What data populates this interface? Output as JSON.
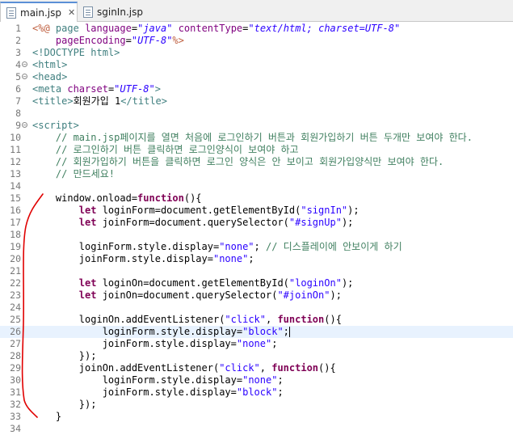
{
  "tabs": [
    {
      "label": "main.jsp",
      "close": "✕"
    },
    {
      "label": "sginIn.jsp"
    }
  ],
  "colors": {
    "tag": "#3f7f7f",
    "attr": "#7f007f",
    "string": "#2a00ff",
    "comment": "#3f7f5f",
    "keyword": "#7f0055",
    "directive": "#bf5f3f",
    "current_line": "#e8f2fe",
    "annotation": "#e00000"
  },
  "editor": {
    "current_line": 26,
    "lines": [
      {
        "n": "1",
        "fold": false,
        "tokens": [
          [
            "dir",
            "<%@"
          ],
          [
            "plain",
            " "
          ],
          [
            "tag",
            "page"
          ],
          [
            "plain",
            " "
          ],
          [
            "attr",
            "language"
          ],
          [
            "plain",
            "="
          ],
          [
            "str",
            "\"java\""
          ],
          [
            "plain",
            " "
          ],
          [
            "attr",
            "contentType"
          ],
          [
            "plain",
            "="
          ],
          [
            "str",
            "\"text/html; charset=UTF-8\""
          ]
        ]
      },
      {
        "n": "2",
        "fold": false,
        "tokens": [
          [
            "plain",
            "    "
          ],
          [
            "attr",
            "pageEncoding"
          ],
          [
            "plain",
            "="
          ],
          [
            "str",
            "\"UTF-8\""
          ],
          [
            "dir",
            "%>"
          ]
        ]
      },
      {
        "n": "3",
        "fold": false,
        "tokens": [
          [
            "tag",
            "<!DOCTYPE html>"
          ]
        ]
      },
      {
        "n": "4",
        "fold": true,
        "tokens": [
          [
            "tag",
            "<html>"
          ]
        ]
      },
      {
        "n": "5",
        "fold": true,
        "tokens": [
          [
            "tag",
            "<head>"
          ]
        ]
      },
      {
        "n": "6",
        "fold": false,
        "tokens": [
          [
            "tag",
            "<meta"
          ],
          [
            "plain",
            " "
          ],
          [
            "attr",
            "charset"
          ],
          [
            "plain",
            "="
          ],
          [
            "str",
            "\"UTF-8\""
          ],
          [
            "tag",
            ">"
          ]
        ]
      },
      {
        "n": "7",
        "fold": false,
        "tokens": [
          [
            "tag",
            "<title>"
          ],
          [
            "plain",
            "회원가입 1"
          ],
          [
            "tag",
            "</title>"
          ]
        ]
      },
      {
        "n": "8",
        "fold": false,
        "tokens": []
      },
      {
        "n": "9",
        "fold": true,
        "tokens": [
          [
            "tag",
            "<script>"
          ]
        ]
      },
      {
        "n": "10",
        "fold": false,
        "tokens": [
          [
            "com",
            "    // main.jsp페이지를 열면 처음에 로그인하기 버튼과 회원가입하기 버튼 두개만 보여야 한다."
          ]
        ]
      },
      {
        "n": "11",
        "fold": false,
        "tokens": [
          [
            "com",
            "    // 로그인하기 버튼 클릭하면 로그인양식이 보여야 하고"
          ]
        ]
      },
      {
        "n": "12",
        "fold": false,
        "tokens": [
          [
            "com",
            "    // 회원가입하기 버튼을 클릭하면 로그인 양식은 안 보이고 회원가입양식만 보여야 한다."
          ]
        ]
      },
      {
        "n": "13",
        "fold": false,
        "tokens": [
          [
            "com",
            "    // 만드세요!"
          ]
        ]
      },
      {
        "n": "14",
        "fold": false,
        "tokens": []
      },
      {
        "n": "15",
        "fold": false,
        "tokens": [
          [
            "plain",
            "    window.onload="
          ],
          [
            "kw",
            "function"
          ],
          [
            "plain",
            "(){"
          ]
        ]
      },
      {
        "n": "16",
        "fold": false,
        "tokens": [
          [
            "plain",
            "        "
          ],
          [
            "kw",
            "let"
          ],
          [
            "plain",
            " loginForm=document.getElementById("
          ],
          [
            "strjs",
            "\"signIn\""
          ],
          [
            "plain",
            ");"
          ]
        ]
      },
      {
        "n": "17",
        "fold": false,
        "tokens": [
          [
            "plain",
            "        "
          ],
          [
            "kw",
            "let"
          ],
          [
            "plain",
            " joinForm=document.querySelector("
          ],
          [
            "strjs",
            "\"#signUp\""
          ],
          [
            "plain",
            ");"
          ]
        ]
      },
      {
        "n": "18",
        "fold": false,
        "tokens": []
      },
      {
        "n": "19",
        "fold": false,
        "tokens": [
          [
            "plain",
            "        loginForm.style.display="
          ],
          [
            "strjs",
            "\"none\""
          ],
          [
            "plain",
            "; "
          ],
          [
            "com",
            "// 디스플레이에 안보이게 하기"
          ]
        ]
      },
      {
        "n": "20",
        "fold": false,
        "tokens": [
          [
            "plain",
            "        joinForm.style.display="
          ],
          [
            "strjs",
            "\"none\""
          ],
          [
            "plain",
            ";"
          ]
        ]
      },
      {
        "n": "21",
        "fold": false,
        "tokens": []
      },
      {
        "n": "22",
        "fold": false,
        "tokens": [
          [
            "plain",
            "        "
          ],
          [
            "kw",
            "let"
          ],
          [
            "plain",
            " loginOn=document.getElementById("
          ],
          [
            "strjs",
            "\"loginOn\""
          ],
          [
            "plain",
            ");"
          ]
        ]
      },
      {
        "n": "23",
        "fold": false,
        "tokens": [
          [
            "plain",
            "        "
          ],
          [
            "kw",
            "let"
          ],
          [
            "plain",
            " joinOn=document.querySelector("
          ],
          [
            "strjs",
            "\"#joinOn\""
          ],
          [
            "plain",
            ");"
          ]
        ]
      },
      {
        "n": "24",
        "fold": false,
        "tokens": []
      },
      {
        "n": "25",
        "fold": false,
        "tokens": [
          [
            "plain",
            "        loginOn.addEventListener("
          ],
          [
            "strjs",
            "\"click\""
          ],
          [
            "plain",
            ", "
          ],
          [
            "kw",
            "function"
          ],
          [
            "plain",
            "(){"
          ]
        ]
      },
      {
        "n": "26",
        "fold": false,
        "tokens": [
          [
            "plain",
            "            loginForm.style.display="
          ],
          [
            "strjs",
            "\"block\""
          ],
          [
            "plain",
            ";"
          ],
          [
            "caret",
            ""
          ]
        ]
      },
      {
        "n": "27",
        "fold": false,
        "tokens": [
          [
            "plain",
            "            joinForm.style.display="
          ],
          [
            "strjs",
            "\"none\""
          ],
          [
            "plain",
            ";"
          ]
        ]
      },
      {
        "n": "28",
        "fold": false,
        "tokens": [
          [
            "plain",
            "        });"
          ]
        ]
      },
      {
        "n": "29",
        "fold": false,
        "tokens": [
          [
            "plain",
            "        joinOn.addEventListener("
          ],
          [
            "strjs",
            "\"click\""
          ],
          [
            "plain",
            ", "
          ],
          [
            "kw",
            "function"
          ],
          [
            "plain",
            "(){"
          ]
        ]
      },
      {
        "n": "30",
        "fold": false,
        "tokens": [
          [
            "plain",
            "            loginForm.style.display="
          ],
          [
            "strjs",
            "\"none\""
          ],
          [
            "plain",
            ";"
          ]
        ]
      },
      {
        "n": "31",
        "fold": false,
        "tokens": [
          [
            "plain",
            "            joinForm.style.display="
          ],
          [
            "strjs",
            "\"block\""
          ],
          [
            "plain",
            ";"
          ]
        ]
      },
      {
        "n": "32",
        "fold": false,
        "tokens": [
          [
            "plain",
            "        });"
          ]
        ]
      },
      {
        "n": "33",
        "fold": false,
        "tokens": [
          [
            "plain",
            "    }"
          ]
        ]
      },
      {
        "n": "34",
        "fold": false,
        "tokens": []
      }
    ]
  }
}
